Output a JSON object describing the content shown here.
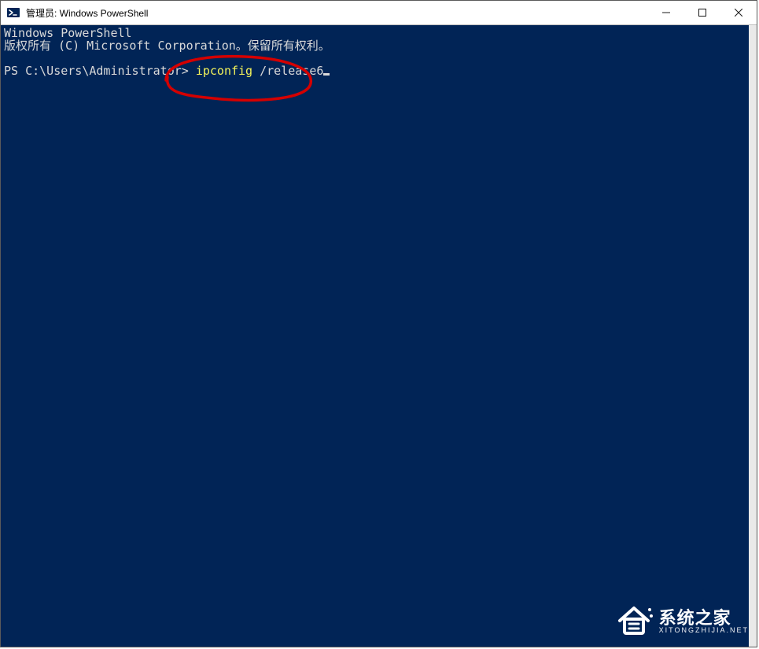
{
  "window": {
    "title": "管理员: Windows PowerShell"
  },
  "terminal": {
    "header_line1": "Windows PowerShell",
    "header_line2": "版权所有 (C) Microsoft Corporation。保留所有权利。",
    "prompt": "PS C:\\Users\\Administrator> ",
    "command": "ipconfig ",
    "argument": "/release6"
  },
  "annotation": {
    "highlight": "ipconfig /release6",
    "color": "#d40000"
  },
  "watermark": {
    "name_cn": "系统之家",
    "name_en": "XITONGZHIJIA.NET"
  },
  "colors": {
    "terminal_bg": "#012456",
    "terminal_fg": "#d9d9d9",
    "command_fg": "#f2f25a"
  }
}
